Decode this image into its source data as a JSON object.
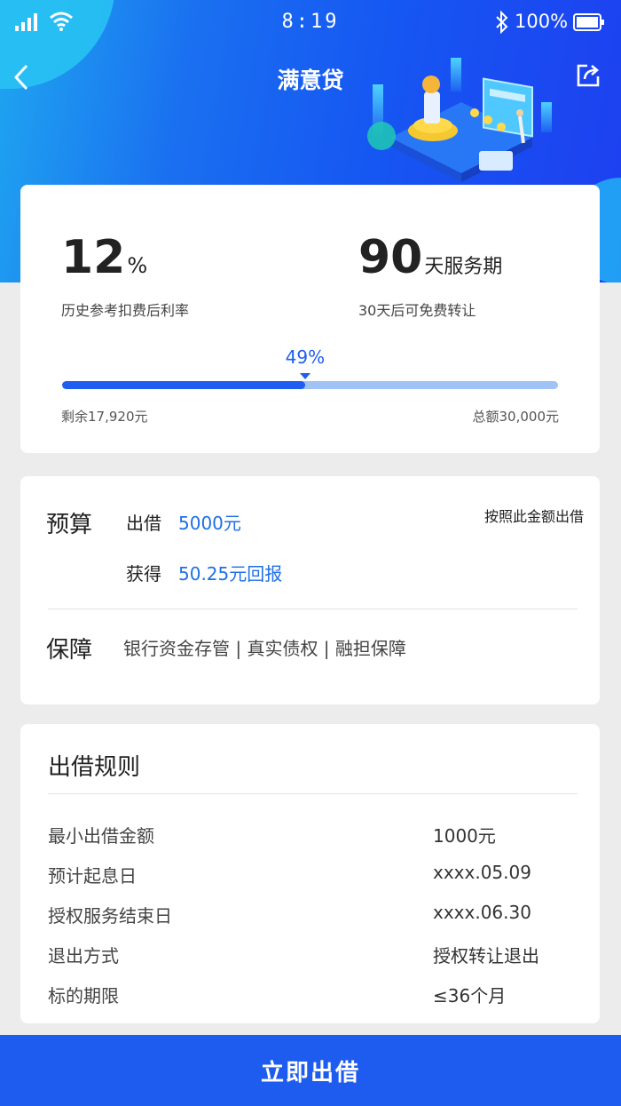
{
  "status_bar": {
    "time": "8:19",
    "battery": "100%"
  },
  "nav": {
    "title": "满意贷"
  },
  "summary": {
    "rate_value": "12",
    "rate_unit": "%",
    "rate_label": "历史参考扣费后利率",
    "term_value": "90",
    "term_unit": "天服务期",
    "term_label": "30天后可免费转让",
    "progress": 0.49,
    "progress_label": "49%",
    "remaining": "剩余17,920元",
    "total": "总额30,000元"
  },
  "budget": {
    "title": "预算",
    "lend_label": "出借",
    "lend_value": "5000元",
    "gain_label": "获得",
    "gain_value": "50.25元回报",
    "by_amount": "按照此金额出借",
    "guarantee_title": "保障",
    "guarantee_text": "银行资金存管 | 真实债权 |  融担保障"
  },
  "rules": {
    "title": "出借规则",
    "rows": [
      {
        "key": "最小出借金额",
        "value": "1000元"
      },
      {
        "key": "预计起息日",
        "value": "xxxx.05.09"
      },
      {
        "key": "授权服务结束日",
        "value": "xxxx.06.30"
      },
      {
        "key": "退出方式",
        "value": "授权转让退出"
      },
      {
        "key": "标的期限",
        "value": "≤36个月"
      }
    ]
  },
  "cta": {
    "label": "立即出借"
  },
  "colors": {
    "accent": "#1e5ef0",
    "link": "#1e6fe8",
    "track": "#9fc3f5"
  },
  "icons": [
    "signal-icon",
    "wifi-icon",
    "bluetooth-icon",
    "battery-icon",
    "back-arrow-icon",
    "share-icon"
  ]
}
